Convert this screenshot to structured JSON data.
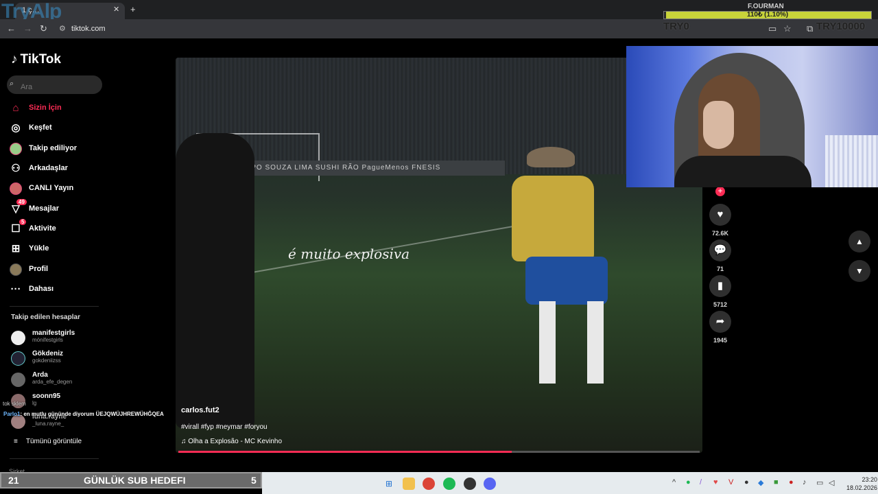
{
  "browser": {
    "tab_title": "1 ҫ…",
    "url": "tiktok.com",
    "logo_overlay": "TryAlp"
  },
  "donation": {
    "title": "F.OURMAN",
    "progress_text": "110₺ (1.10%)",
    "progress_fraction": 0.011,
    "left_amount": "TRY0",
    "right_amount": "TRY10000"
  },
  "sidebar": {
    "logo": "TikTok",
    "search_placeholder": "Ara",
    "nav": [
      {
        "label": "Sizin İçin",
        "icon": "home-icon"
      },
      {
        "label": "Keşfet",
        "icon": "compass-icon"
      },
      {
        "label": "Takip ediliyor",
        "icon": "following-avatar-icon"
      },
      {
        "label": "Arkadaşlar",
        "icon": "friends-icon"
      },
      {
        "label": "CANLI Yayın",
        "icon": "live-avatar-icon"
      },
      {
        "label": "Mesajlar",
        "icon": "messages-icon",
        "badge": "49"
      },
      {
        "label": "Aktivite",
        "icon": "activity-icon",
        "badge": "5"
      },
      {
        "label": "Yükle",
        "icon": "upload-icon"
      },
      {
        "label": "Profil",
        "icon": "profile-avatar-icon"
      },
      {
        "label": "Dahası",
        "icon": "more-icon"
      }
    ],
    "following_title": "Takip edilen hesaplar",
    "following": [
      {
        "name": "manifestgirls",
        "handle": "mónifestgirls"
      },
      {
        "name": "Gökdeniz",
        "handle": "gokdeniizss"
      },
      {
        "name": "Arda",
        "handle": "arda_efe_degen"
      },
      {
        "name": "soonn95",
        "handle": "lg"
      },
      {
        "name": "luna.rayne",
        "handle": "_luna.rayne_"
      }
    ],
    "see_all": "Tümünü görüntüle",
    "footer": "Şirket"
  },
  "video": {
    "caption": "é muito explosiva",
    "author": "carlos.fut2",
    "tags": "#virall #fyp #neymar #foryou",
    "music": "Olha a Explosão - MC Kevinho",
    "progress_fraction": 0.64,
    "adboard": "GRUPO SOUZA LIMA   SUSHI RÃO   PagueMenos   FNESIS"
  },
  "actions": {
    "likes": "72.6K",
    "comments": "71",
    "saves": "5712",
    "shares": "1945"
  },
  "chat": {
    "line_top": "tok sklem",
    "user": "Parlo1",
    "message": ": en mutlu gününde diyorum ÜEJQWÜJHREWÜHĞQEA"
  },
  "subgoal": {
    "current": "21",
    "title": "GÜNLÜK SUB HEDEFI",
    "target": "5"
  },
  "clock": {
    "time": "23:20",
    "date": "18.02.2026"
  },
  "colors": {
    "accent": "#fe2c55",
    "donation_bar": "#c8d33a"
  }
}
